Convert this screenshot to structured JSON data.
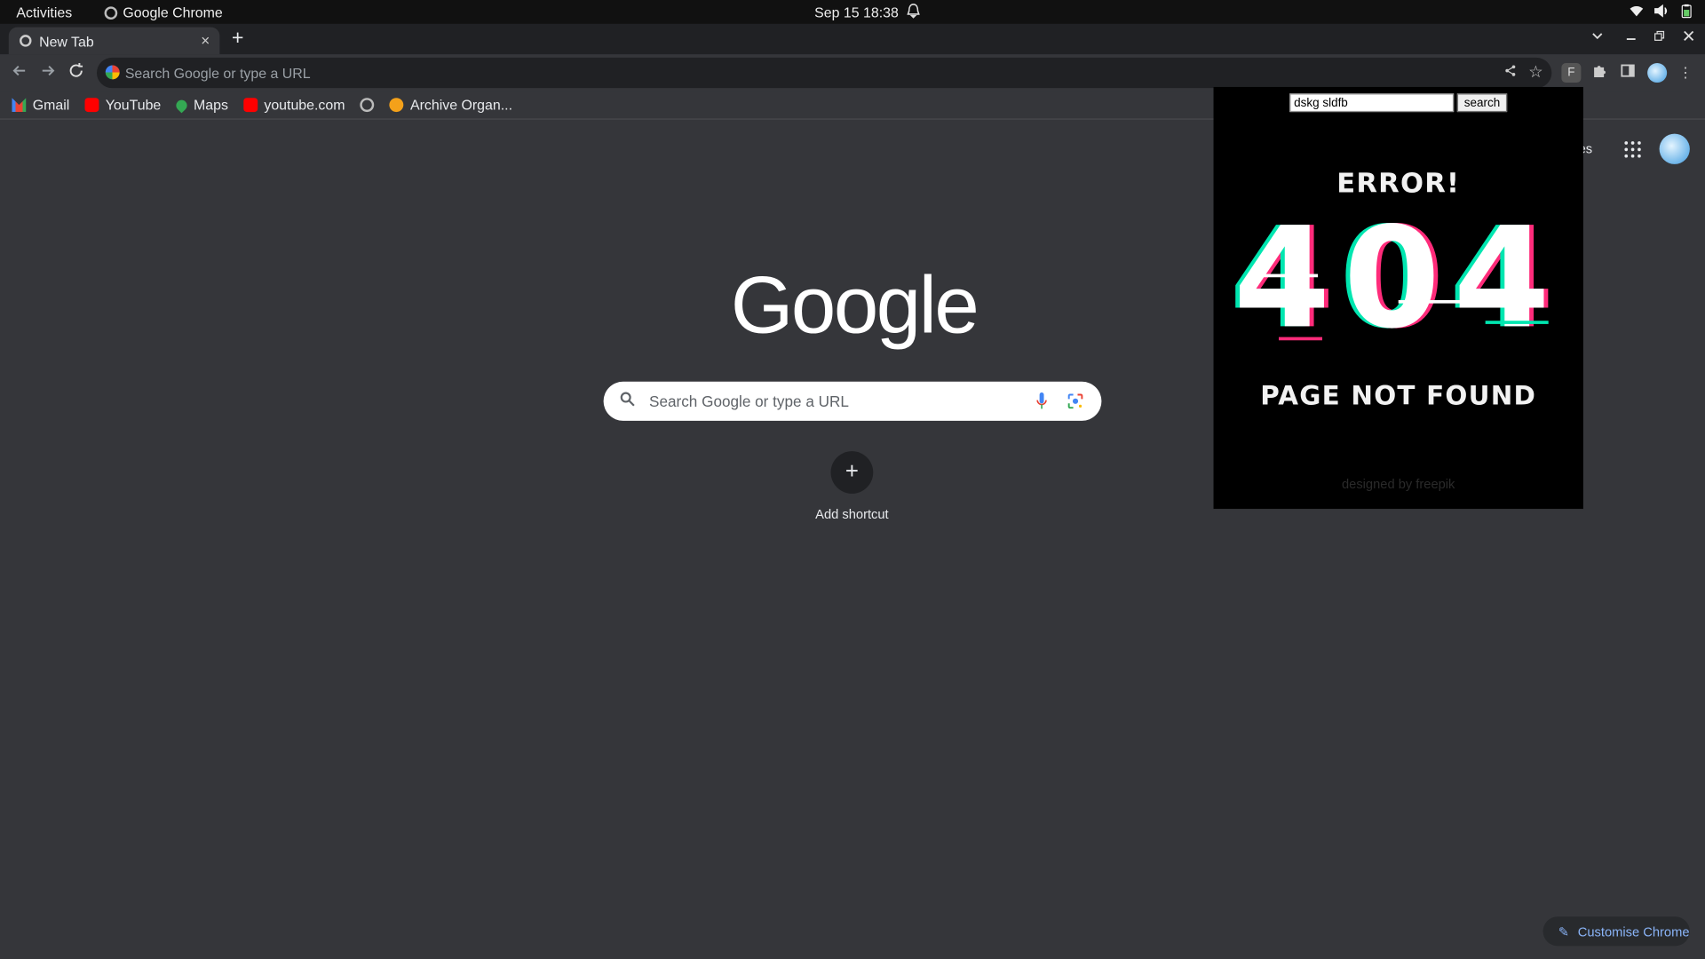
{
  "system_bar": {
    "activities": "Activities",
    "app_name": "Google Chrome",
    "datetime": "Sep 15  18:38"
  },
  "tabs": [
    {
      "title": "New Tab",
      "close": "×"
    }
  ],
  "new_tab_glyph": "+",
  "toolbar": {
    "omnibox_placeholder": "Search Google or type a URL",
    "extension_letter": "F"
  },
  "bookmarks": [
    {
      "label": "Gmail",
      "icon": "gmail-icon"
    },
    {
      "label": "YouTube",
      "icon": "youtube-icon"
    },
    {
      "label": "Maps",
      "icon": "maps-icon"
    },
    {
      "label": "youtube.com",
      "icon": "youtube-icon"
    },
    {
      "label": "",
      "icon": "globe-icon"
    },
    {
      "label": "Archive Organ...",
      "icon": "archive-icon"
    }
  ],
  "ntp": {
    "logo": "Google",
    "search_placeholder": "Search Google or type a URL",
    "add_shortcut": "Add shortcut",
    "images_link": "ges",
    "customise": "Customise Chrome"
  },
  "popup": {
    "input_value": "dskg sldfb",
    "button_label": "search",
    "error_title": "ERROR!",
    "error_code": "404",
    "error_subtitle": "PAGE NOT FOUND",
    "credit": "designed by freepik"
  },
  "colors": {
    "page_bg": "#35363a",
    "tabstrip_bg": "#202124",
    "accent_link": "#8ab4f8",
    "glitch_cyan": "#00e6b0",
    "glitch_pink": "#ff2b7a"
  }
}
